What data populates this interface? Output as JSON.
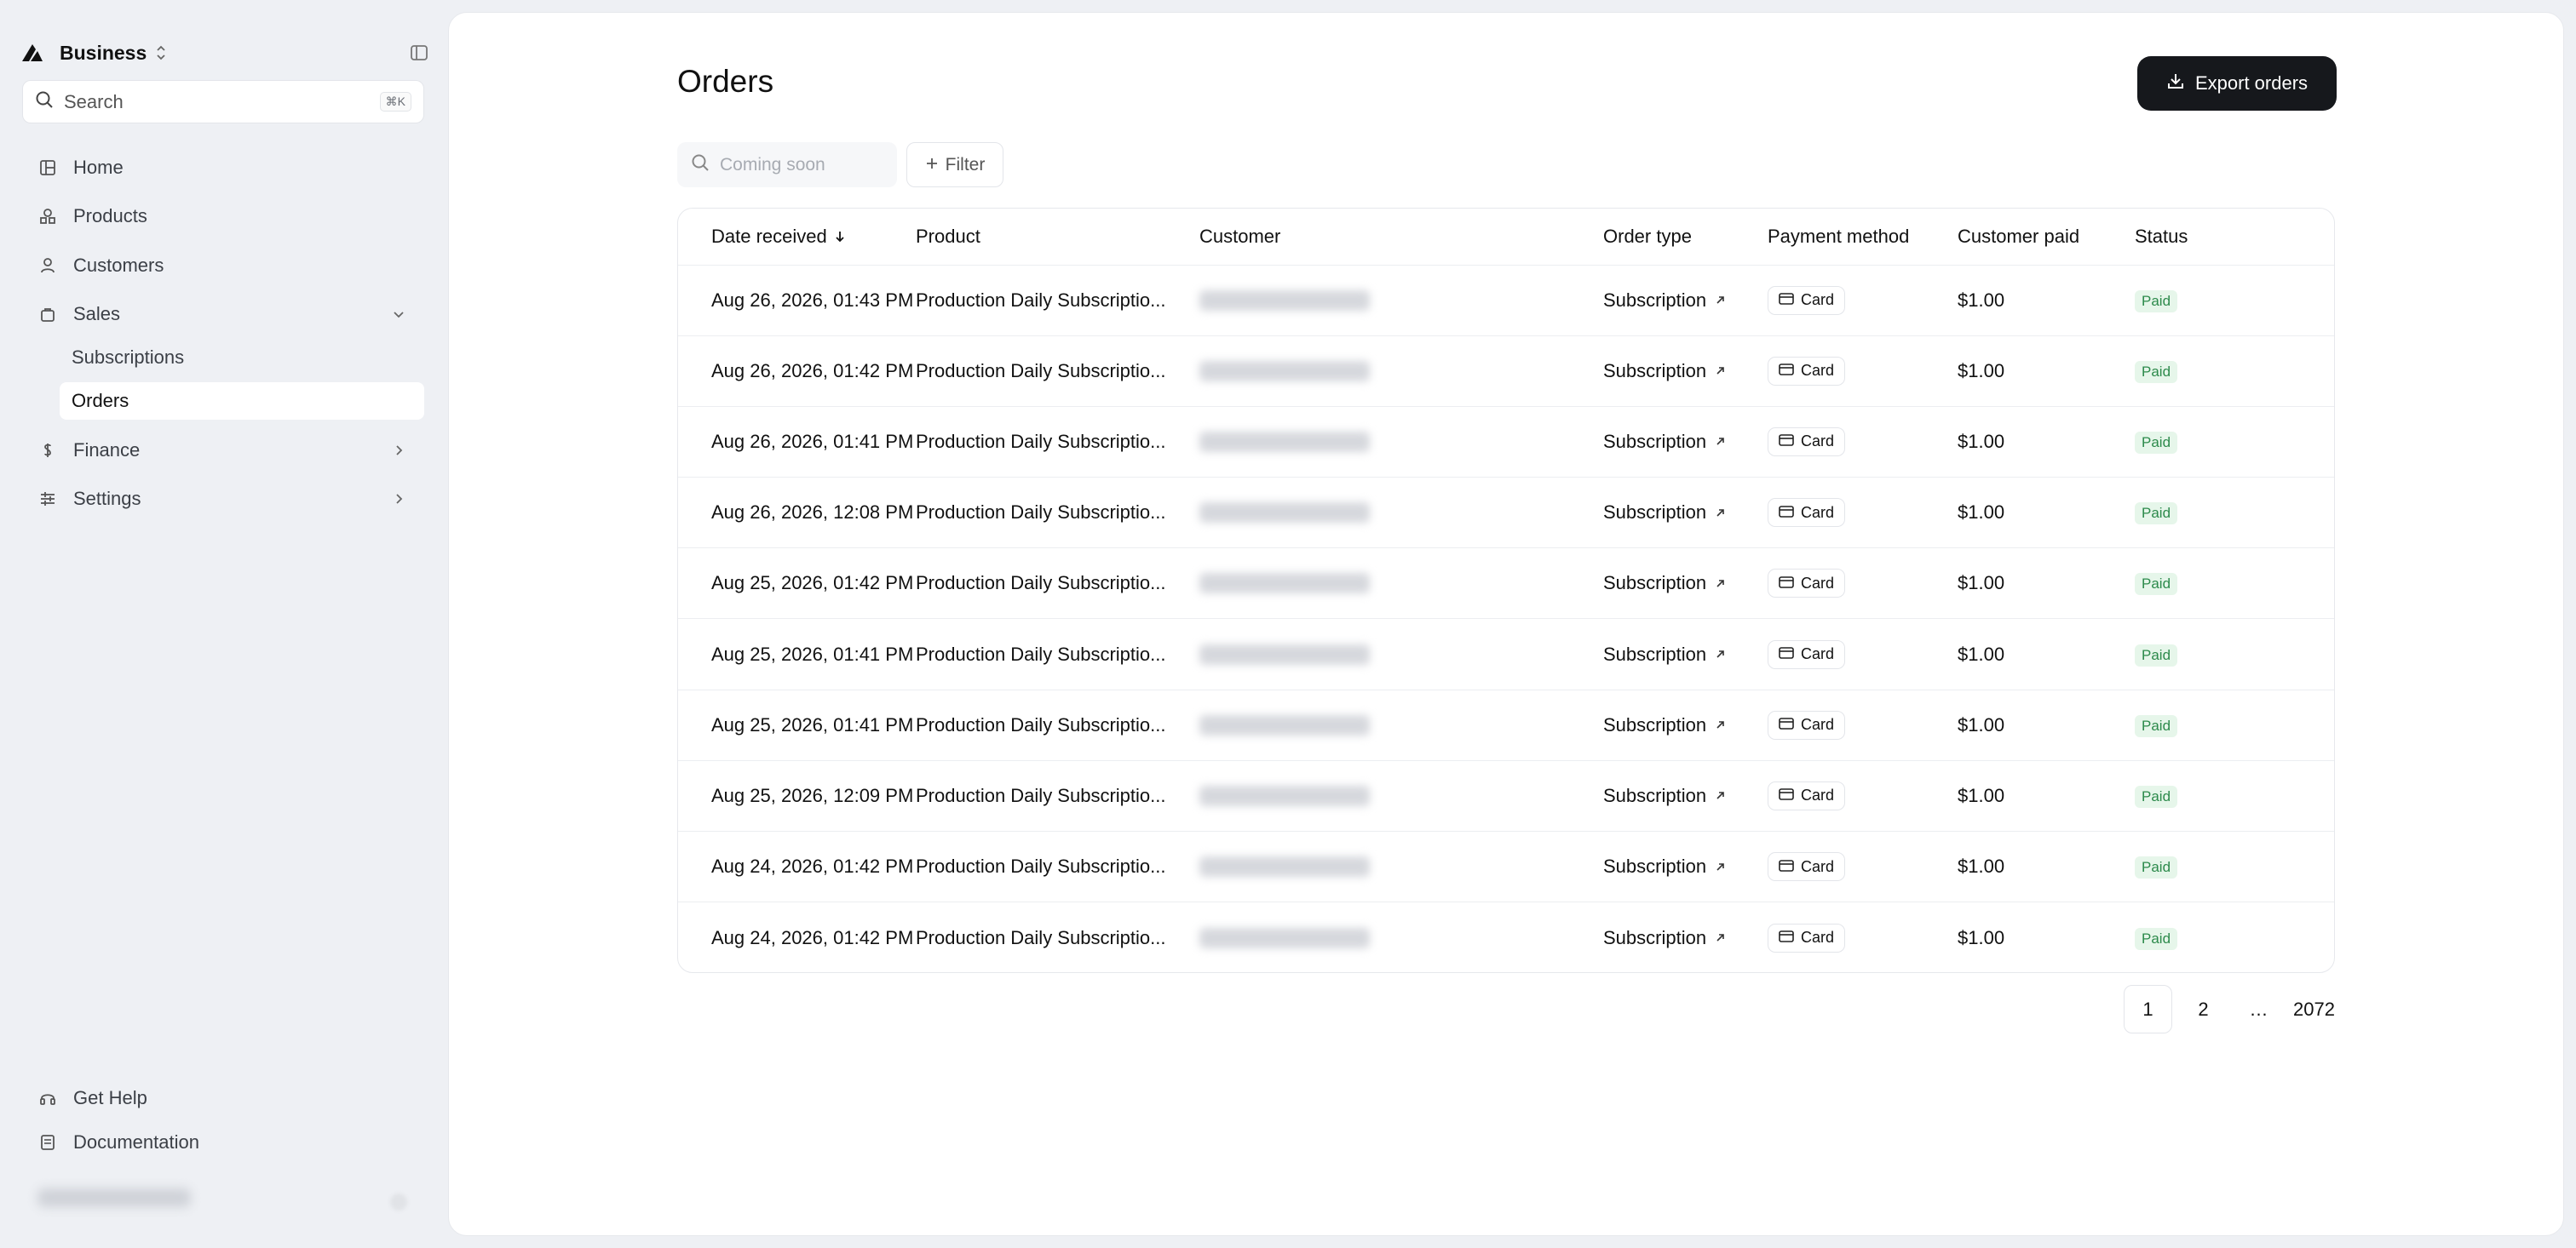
{
  "sidebar": {
    "brand": "Business",
    "search": {
      "label": "Search",
      "shortcut": "⌘K"
    },
    "nav": [
      {
        "label": "Home",
        "icon": "home-icon"
      },
      {
        "label": "Products",
        "icon": "shapes-icon"
      },
      {
        "label": "Customers",
        "icon": "user-icon"
      },
      {
        "label": "Sales",
        "icon": "bag-icon",
        "expanded": true,
        "children": [
          {
            "label": "Subscriptions"
          },
          {
            "label": "Orders",
            "active": true
          }
        ]
      },
      {
        "label": "Finance",
        "icon": "dollar-icon"
      },
      {
        "label": "Settings",
        "icon": "sliders-icon"
      }
    ],
    "footer": [
      {
        "label": "Get Help",
        "icon": "headset-icon"
      },
      {
        "label": "Documentation",
        "icon": "document-icon"
      }
    ]
  },
  "main": {
    "title": "Orders",
    "export_label": "Export orders",
    "search_placeholder": "Coming soon",
    "filter_label": "Filter",
    "columns": [
      "Date received",
      "Product",
      "Customer",
      "Order type",
      "Payment method",
      "Customer paid",
      "Status"
    ],
    "rows": [
      {
        "date": "Aug 26, 2026, 01:43 PM",
        "product": "Production Daily Subscriptio...",
        "order_type": "Subscription",
        "payment": "Card",
        "paid": "$1.00",
        "status": "Paid"
      },
      {
        "date": "Aug 26, 2026, 01:42 PM",
        "product": "Production Daily Subscriptio...",
        "order_type": "Subscription",
        "payment": "Card",
        "paid": "$1.00",
        "status": "Paid"
      },
      {
        "date": "Aug 26, 2026, 01:41 PM",
        "product": "Production Daily Subscriptio...",
        "order_type": "Subscription",
        "payment": "Card",
        "paid": "$1.00",
        "status": "Paid"
      },
      {
        "date": "Aug 26, 2026, 12:08 PM",
        "product": "Production Daily Subscriptio...",
        "order_type": "Subscription",
        "payment": "Card",
        "paid": "$1.00",
        "status": "Paid"
      },
      {
        "date": "Aug 25, 2026, 01:42 PM",
        "product": "Production Daily Subscriptio...",
        "order_type": "Subscription",
        "payment": "Card",
        "paid": "$1.00",
        "status": "Paid"
      },
      {
        "date": "Aug 25, 2026, 01:41 PM",
        "product": "Production Daily Subscriptio...",
        "order_type": "Subscription",
        "payment": "Card",
        "paid": "$1.00",
        "status": "Paid"
      },
      {
        "date": "Aug 25, 2026, 01:41 PM",
        "product": "Production Daily Subscriptio...",
        "order_type": "Subscription",
        "payment": "Card",
        "paid": "$1.00",
        "status": "Paid"
      },
      {
        "date": "Aug 25, 2026, 12:09 PM",
        "product": "Production Daily Subscriptio...",
        "order_type": "Subscription",
        "payment": "Card",
        "paid": "$1.00",
        "status": "Paid"
      },
      {
        "date": "Aug 24, 2026, 01:42 PM",
        "product": "Production Daily Subscriptio...",
        "order_type": "Subscription",
        "payment": "Card",
        "paid": "$1.00",
        "status": "Paid"
      },
      {
        "date": "Aug 24, 2026, 01:42 PM",
        "product": "Production Daily Subscriptio...",
        "order_type": "Subscription",
        "payment": "Card",
        "paid": "$1.00",
        "status": "Paid"
      }
    ],
    "pagination": {
      "pages": [
        "1",
        "2",
        "…",
        "2072"
      ],
      "current": "1"
    }
  },
  "colors": {
    "primary_button": "#16181c",
    "status_paid_text": "#2c8a4b",
    "status_paid_bg": "#e6f6ea",
    "sidebar_bg": "#eef0f4"
  }
}
